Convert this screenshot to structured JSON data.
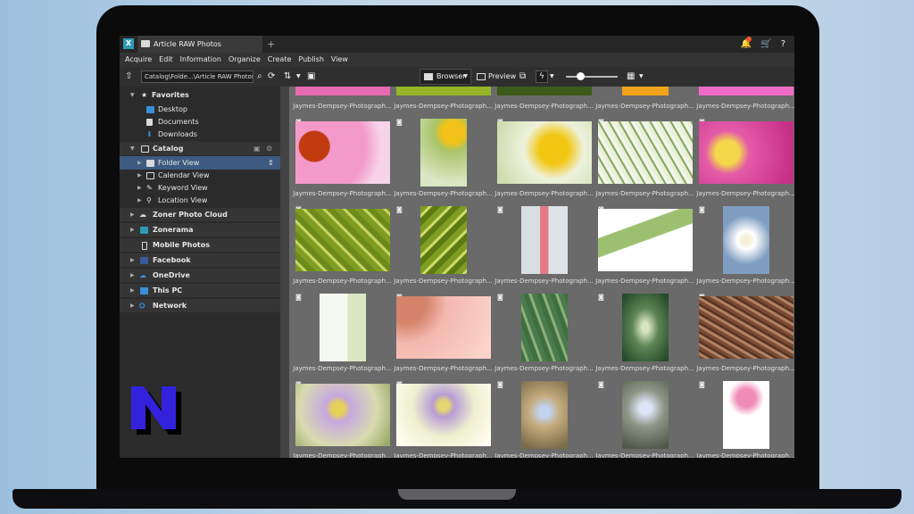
{
  "window": {
    "tab_title": "Article RAW Photos",
    "new_tab": "+",
    "app_icon": "X",
    "help": "?"
  },
  "menu": [
    "Acquire",
    "Edit",
    "Information",
    "Organize",
    "Create",
    "Publish",
    "View"
  ],
  "toolbar": {
    "path": "Catalog\\Folde...\\Article RAW Photos",
    "browser_label": "Browser",
    "preview_label": "Preview"
  },
  "sidebar": {
    "favorites": {
      "label": "Favorites",
      "items": [
        "Desktop",
        "Documents",
        "Downloads"
      ]
    },
    "catalog": {
      "label": "Catalog",
      "items": [
        "Folder View",
        "Calendar View",
        "Keyword View",
        "Location View"
      ]
    },
    "sources": [
      "Zoner Photo Cloud",
      "Zonerama",
      "Mobile Photos",
      "Facebook",
      "OneDrive",
      "This PC",
      "Network"
    ]
  },
  "grid": {
    "caption": "Jaymes-Dempsey-Photograph...",
    "rows": [
      [
        "pink coneflower macro",
        "yellow tulip",
        "yellow poppy",
        "white flower umbel",
        "pink flower stamens"
      ],
      [
        "green leaf veins",
        "green leaf veins",
        "pink stem",
        "fern frond",
        "white daisy"
      ],
      [
        "thistle stems",
        "pink petal",
        "green palm",
        "green leaf",
        "dry pine needles"
      ],
      [
        "purple cosmos",
        "purple cosmos",
        "small blue flower",
        "small blue flower",
        "pink poppy"
      ]
    ]
  },
  "colors": {
    "screen_bg": "#434343",
    "grid_bg": "#6a6a6a",
    "sidebar_bg": "#2b2b2b",
    "selection": "#3d5a80",
    "logo": "#3322dd"
  }
}
